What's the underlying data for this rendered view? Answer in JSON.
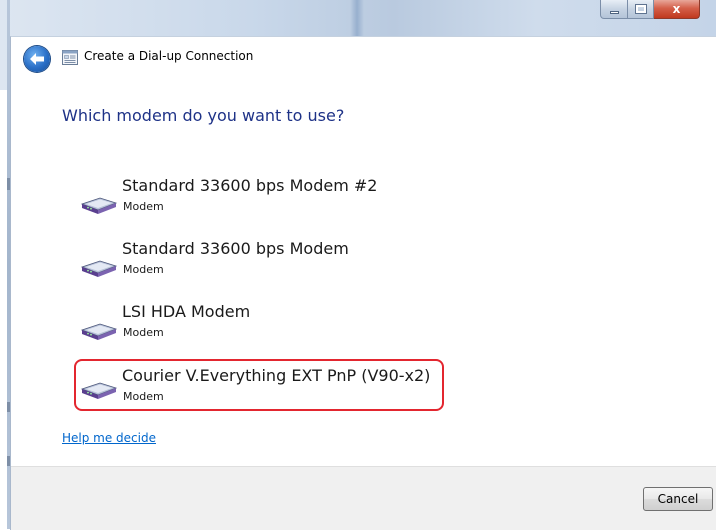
{
  "window": {
    "title": "Create a Dial-up Connection",
    "close_glyph": "x"
  },
  "heading": "Which modem do you want to use?",
  "modems": [
    {
      "name": "Standard 33600 bps Modem #2",
      "type": "Modem",
      "selected": false
    },
    {
      "name": "Standard 33600 bps Modem",
      "type": "Modem",
      "selected": false
    },
    {
      "name": "LSI HDA Modem",
      "type": "Modem",
      "selected": false
    },
    {
      "name": "Courier V.Everything EXT PnP (V90-x2)",
      "type": "Modem",
      "selected": true
    }
  ],
  "help_link": "Help me decide",
  "footer": {
    "cancel_label": "Cancel"
  },
  "icons": {
    "back": "back-arrow-icon",
    "window": "dial-up-connection-icon",
    "modem": "modem-icon"
  },
  "colors": {
    "heading": "#1e3287",
    "link": "#0066cc",
    "highlight": "#e3262f"
  }
}
